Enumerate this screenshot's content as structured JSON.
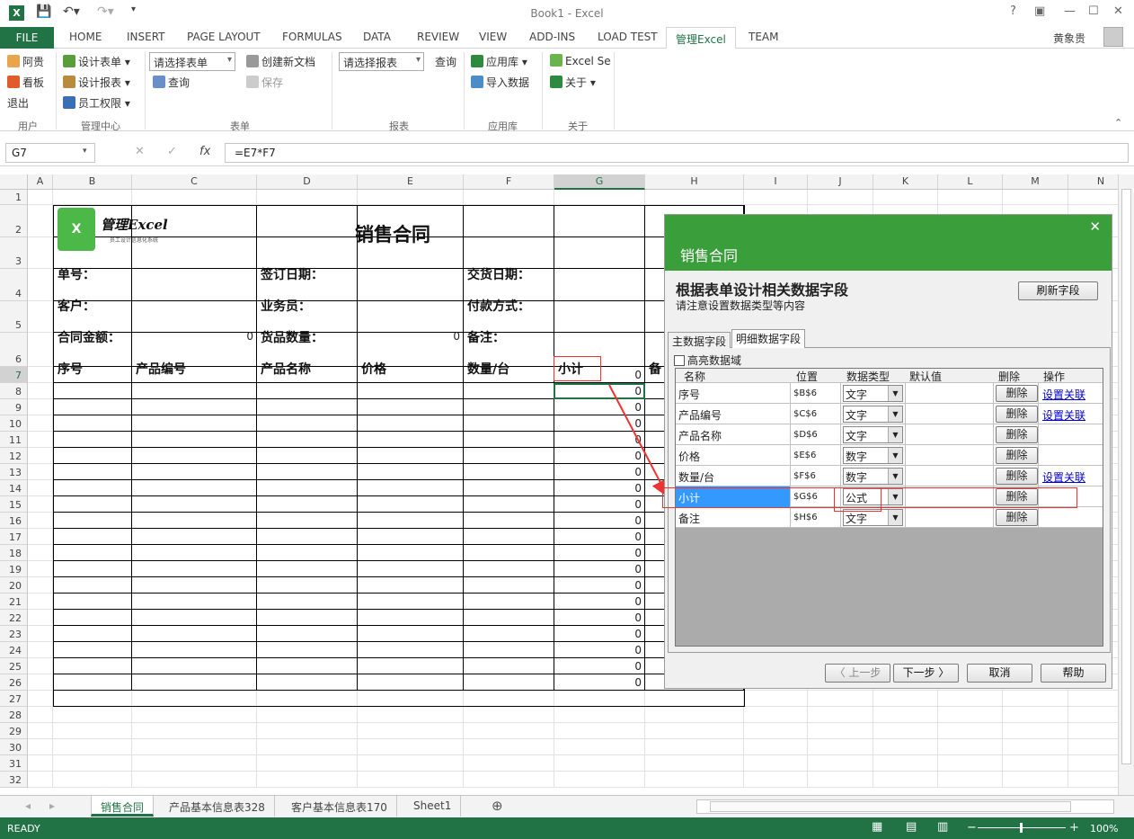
{
  "window": {
    "title": "Book1 - Excel",
    "user": "黄象贵"
  },
  "ribbon_tabs": [
    "FILE",
    "HOME",
    "INSERT",
    "PAGE LAYOUT",
    "FORMULAS",
    "DATA",
    "REVIEW",
    "VIEW",
    "ADD-INS",
    "LOAD TEST",
    "管理Excel",
    "TEAM"
  ],
  "ribbon": {
    "user": {
      "items": [
        "阿贵",
        "看板",
        "退出"
      ],
      "group": "用户"
    },
    "mgmt": {
      "items": [
        "设计表单",
        "设计报表",
        "员工权限"
      ],
      "group": "管理中心"
    },
    "form": {
      "combo": "请选择表单",
      "query": "查询",
      "new_doc": "创建新文档",
      "save": "保存",
      "group": "表单"
    },
    "report": {
      "combo": "请选择报表",
      "query": "查询",
      "group": "报表"
    },
    "apps": {
      "store": "应用库",
      "import": "导入数据",
      "group": "应用库"
    },
    "about": {
      "excel_se": "Excel Se",
      "about": "关于",
      "group": "关于"
    }
  },
  "formula_bar": {
    "name_box": "G7",
    "formula": "=E7*F7"
  },
  "columns": [
    "A",
    "B",
    "C",
    "D",
    "E",
    "F",
    "G",
    "H",
    "I",
    "J",
    "K",
    "L",
    "M",
    "N"
  ],
  "rows": [
    "1",
    "2",
    "3",
    "4",
    "5",
    "6",
    "7",
    "8",
    "9",
    "10",
    "11",
    "12",
    "13",
    "14",
    "15",
    "16",
    "17",
    "18",
    "19",
    "20",
    "21",
    "22",
    "23",
    "24",
    "25",
    "26",
    "27",
    "28",
    "29",
    "30",
    "31",
    "32"
  ],
  "form": {
    "logo_text": "管理Excel",
    "logo_sub": "员工设计信息化系统",
    "title": "销售合同",
    "labels": {
      "order_no": "单号：",
      "sign_date": "签订日期：",
      "delivery_date": "交货日期：",
      "customer": "客户：",
      "salesman": "业务员：",
      "pay_method": "付款方式：",
      "amount": "合同金额：",
      "qty": "货品数量：",
      "remark": "备注："
    },
    "amount_value": "0",
    "qty_value": "0",
    "headers": [
      "序号",
      "产品编号",
      "产品名称",
      "价格",
      "数量/台",
      "小计",
      "备"
    ],
    "subtotals": [
      "0",
      "0",
      "0",
      "0",
      "0",
      "0",
      "0",
      "0",
      "0",
      "0",
      "0",
      "0",
      "0",
      "0",
      "0",
      "0",
      "0",
      "0",
      "0",
      "0"
    ]
  },
  "sheet_tabs": [
    "销售合同",
    "产品基本信息表328",
    "客户基本信息表170",
    "Sheet1"
  ],
  "status": {
    "text": "READY",
    "zoom": "100%"
  },
  "dialog": {
    "title": "销售合同",
    "heading": "根据表单设计相关数据字段",
    "subheading": "请注意设置数据类型等内容",
    "refresh": "刷新字段",
    "tabs": [
      "主数据字段",
      "明细数据字段"
    ],
    "highlight": "高亮数据域",
    "table_headers": [
      "名称",
      "位置",
      "数据类型",
      "默认值",
      "删除",
      "操作"
    ],
    "rows": [
      {
        "name": "序号",
        "pos": "$B$6",
        "type": "文字",
        "del": "删除",
        "op": "设置关联"
      },
      {
        "name": "产品编号",
        "pos": "$C$6",
        "type": "文字",
        "del": "删除",
        "op": "设置关联"
      },
      {
        "name": "产品名称",
        "pos": "$D$6",
        "type": "文字",
        "del": "删除",
        "op": ""
      },
      {
        "name": "价格",
        "pos": "$E$6",
        "type": "数字",
        "del": "删除",
        "op": ""
      },
      {
        "name": "数量/台",
        "pos": "$F$6",
        "type": "数字",
        "del": "删除",
        "op": "设置关联"
      },
      {
        "name": "小计",
        "pos": "$G$6",
        "type": "公式",
        "del": "删除",
        "op": ""
      },
      {
        "name": "备注",
        "pos": "$H$6",
        "type": "文字",
        "del": "删除",
        "op": ""
      }
    ],
    "prev": "〈 上一步",
    "next": "下一步 〉",
    "cancel": "取消",
    "help": "帮助"
  },
  "colors": {
    "accent": "#217346",
    "dialog_header": "#3a9f3a",
    "highlight_row": "#3399ff"
  }
}
